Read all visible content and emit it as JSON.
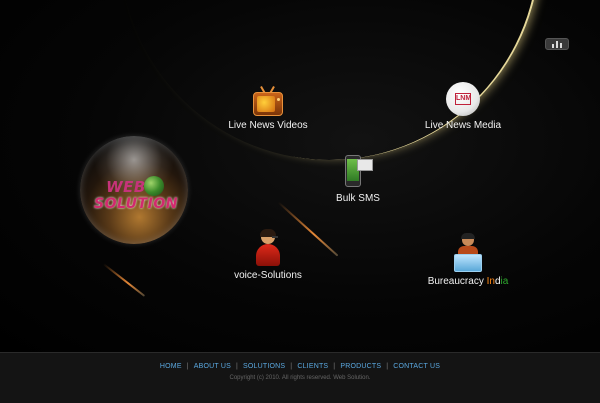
{
  "header": {
    "menu_icon": "bar-chart-icon"
  },
  "logo": {
    "line1": "WEB",
    "line2": "SOLUTION",
    "icon": "globe-icon"
  },
  "items": {
    "videos": {
      "label": "Live News Videos",
      "icon": "tv-icon"
    },
    "media": {
      "label": "Live News Media",
      "icon": "media-logo-icon",
      "mark": "LNM"
    },
    "sms": {
      "label": "Bulk SMS",
      "icon": "phone-envelope-icon"
    },
    "voice": {
      "label": "voice-Solutions",
      "icon": "support-agent-icon"
    },
    "bureau": {
      "label_main": "Bureaucracy ",
      "label_ind": [
        "In",
        "d",
        "ia"
      ],
      "icon": "person-at-desk-icon"
    }
  },
  "footer": {
    "nav": [
      "HOME",
      "ABOUT US",
      "SOLUTIONS",
      "CLIENTS",
      "PRODUCTS",
      "CONTACT US"
    ],
    "separator": "|",
    "copyright": "Copyright (c) 2010. All rights reserved. Web Solution."
  },
  "colors": {
    "background": "#000000",
    "nav_link": "#5aa8e0",
    "logo_pink": "#c6337a",
    "orbit_glow": "#fff0aa",
    "india_saffron": "#ff8a1a",
    "india_green": "#2ea82e"
  }
}
